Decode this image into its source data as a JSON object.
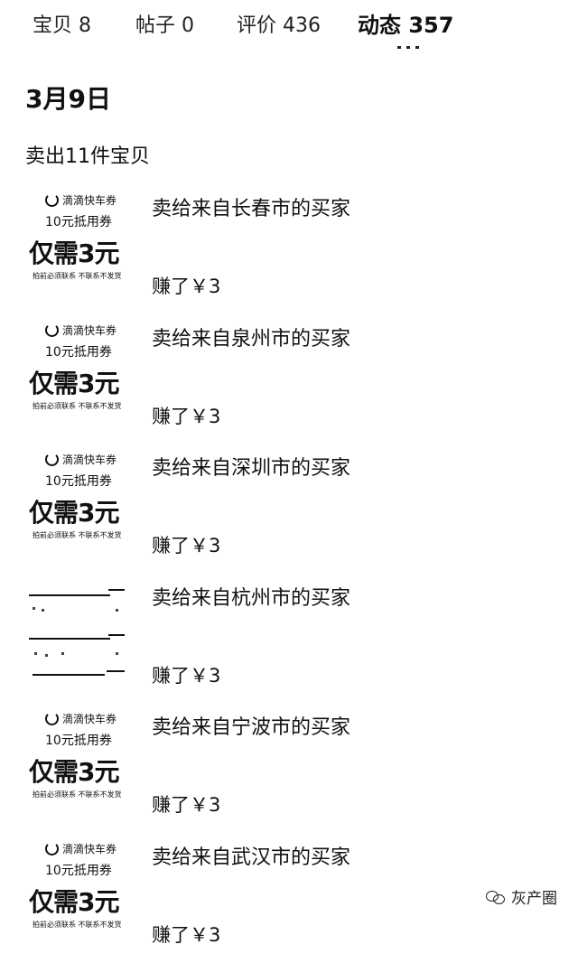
{
  "tabs": [
    {
      "label": "宝贝 8",
      "active": false
    },
    {
      "label": "帖子 0",
      "active": false
    },
    {
      "label": "评价 436",
      "active": false
    },
    {
      "label": "动态 357",
      "active": true
    }
  ],
  "date": "3月9日",
  "summary": "卖出11件宝贝",
  "coupon": {
    "brand": "滴滴快车券",
    "value": "10元抵用券",
    "price": "仅需3元",
    "note": "拍前必须联系 不联系不发货"
  },
  "items": [
    {
      "buyer": "卖给来自长春市的买家",
      "earned": "赚了￥3",
      "thumb": "coupon"
    },
    {
      "buyer": "卖给来自泉州市的买家",
      "earned": "赚了￥3",
      "thumb": "coupon"
    },
    {
      "buyer": "卖给来自深圳市的买家",
      "earned": "赚了￥3",
      "thumb": "coupon"
    },
    {
      "buyer": "卖给来自杭州市的买家",
      "earned": "赚了￥3",
      "thumb": "receipt"
    },
    {
      "buyer": "卖给来自宁波市的买家",
      "earned": "赚了￥3",
      "thumb": "coupon"
    },
    {
      "buyer": "卖给来自武汉市的买家",
      "earned": "赚了￥3",
      "thumb": "coupon"
    }
  ],
  "watermark": {
    "text": "灰产圈",
    "icon": "wechat-icon"
  }
}
